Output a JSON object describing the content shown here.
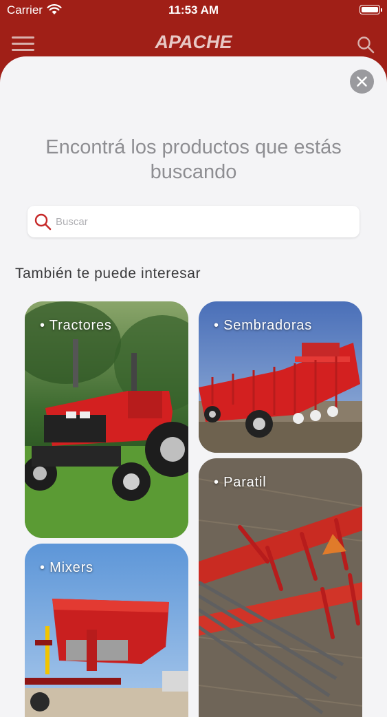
{
  "status_bar": {
    "carrier": "Carrier",
    "time": "11:53 AM"
  },
  "nav": {
    "logo_text": "APACHE",
    "menu_icon": "hamburger-menu-icon",
    "search_icon": "search-icon"
  },
  "search_sheet": {
    "close_icon": "close-icon",
    "heading": "Encontrá los productos que estás buscando",
    "search_placeholder": "Buscar",
    "search_value": "",
    "section_title": "También te puede interesar"
  },
  "categories": [
    {
      "label": "• Tractores"
    },
    {
      "label": "• Sembradoras"
    },
    {
      "label": "• Mixers"
    },
    {
      "label": "• Paratil"
    }
  ],
  "colors": {
    "brand_red": "#a01f17",
    "sheet_background": "#f4f4f6",
    "accent_red": "#c62828",
    "heading_gray": "#8e8e92"
  }
}
